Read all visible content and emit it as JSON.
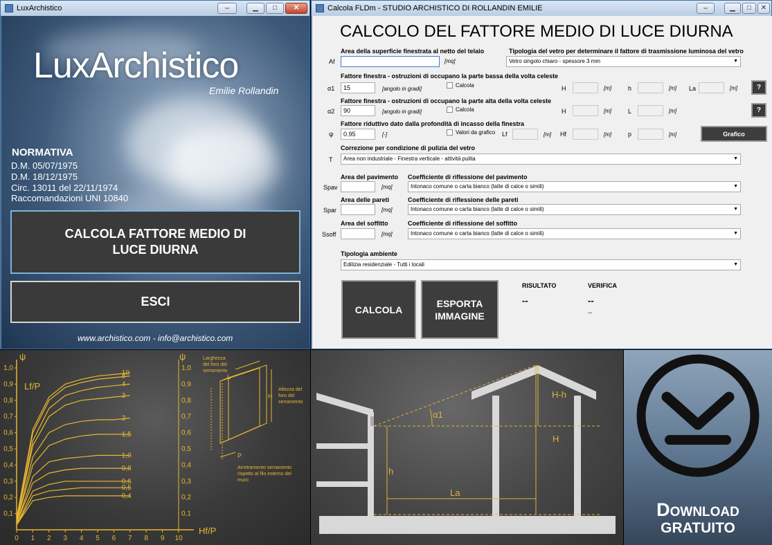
{
  "left_window": {
    "title": "LuxArchistico",
    "app_title": "LuxArchistico",
    "author": "Emilie Rollandin",
    "normativa_title": "NORMATIVA",
    "normativa_lines": [
      "D.M. 05/07/1975",
      "D.M. 18/12/1975",
      "Circ. 13011 del 22/11/1974",
      "Raccomandazioni UNI 10840"
    ],
    "calc_button_line1": "CALCOLA FATTORE MEDIO DI",
    "calc_button_line2": "LUCE DIURNA",
    "exit_button": "ESCI",
    "footer": "www.archistico.com - info@archistico.com"
  },
  "right_window": {
    "title": "Calcola FLDm - STUDIO ARCHISTICO DI ROLLANDIN EMILIE",
    "heading": "CALCOLO DEL FATTORE MEDIO DI LUCE DIURNA",
    "af_label": "Area della superficie finestrata al netto del telaio",
    "af_symbol": "Af",
    "af_value": "",
    "af_unit": "[mq]",
    "glass_label": "Tipologia del vetro per determinare il fattore di trasmissione luminosa del vetro",
    "glass_value": "Vetro singolo chiaro - spessore 3 mm",
    "a1_label": "Fattore finestra - ostruzioni di occupano la parte bassa della volta celeste",
    "a1_symbol": "α1",
    "a1_value": "15",
    "a1_unit": "[angolo in gradi]",
    "a1_calc": "Calcola",
    "a2_label": "Fattore finestra - ostruzioni di occupano la parte alta della volta celeste",
    "a2_symbol": "α2",
    "a2_value": "90",
    "a2_unit": "[angolo in gradi]",
    "a2_calc": "Calcola",
    "psi_label": "Fattore riduttivo dato dalla profondità di incasso della finestra",
    "psi_symbol": "ψ",
    "psi_value": "0.95",
    "psi_unit": "[-]",
    "psi_check": "Valori da grafico",
    "h_label": "H",
    "h2_label": "h",
    "la_label": "La",
    "l_label": "L",
    "lf_label": "Lf",
    "hf_label": "Hf",
    "p_label": "p",
    "m_unit": "[m]",
    "help": "?",
    "graph_button": "Grafico",
    "clean_label": "Correzione per condizione di pulizia del vetro",
    "clean_symbol": "T",
    "clean_value": "Area non industriale - Finestra verticale - attività pulita",
    "floor_area_label": "Area del pavimento",
    "floor_symbol": "Spav",
    "floor_unit": "[mq]",
    "floor_coef_label": "Coefficiente di riflessione del pavimento",
    "floor_coef_value": "Intonaco comune o carta bianco (latte di calce o simili)",
    "wall_area_label": "Area delle pareti",
    "wall_symbol": "Spar",
    "wall_unit": "[mq]",
    "wall_coef_label": "Coefficiente di riflessione delle pareti",
    "wall_coef_value": "Intonaco comune o carta bianco (latte di calce o simili)",
    "ceil_area_label": "Area del soffitto",
    "ceil_symbol": "Ssoff",
    "ceil_unit": "[mq]",
    "ceil_coef_label": "Coefficiente di riflessione del soffitto",
    "ceil_coef_value": "Intonaco comune o carta bianco (latte di calce o simili)",
    "env_label": "Tipologia ambiente",
    "env_value": "Edilizia residenziale - Tutti i locali",
    "calc_button": "CALCOLA",
    "export_line1": "ESPORTA",
    "export_line2": "IMMAGINE",
    "result_label": "RISULTATO",
    "result_value": "--",
    "verify_label": "VERIFICA",
    "verify_value": "--",
    "verify_sub": "--"
  },
  "chart_data": {
    "type": "line",
    "xlabel": "Hf/P",
    "ylabel": "ψ",
    "xlim": [
      0,
      10
    ],
    "ylim": [
      0,
      1
    ],
    "x_ticks": [
      "0",
      "1",
      "2",
      "3",
      "4",
      "5",
      "6",
      "7",
      "8",
      "9",
      "10"
    ],
    "y_ticks": [
      "0,1",
      "0,2",
      "0,3",
      "0,4",
      "0,5",
      "0,6",
      "0,7",
      "0,8",
      "0,9",
      "1,0"
    ],
    "curve_family_label": "Lf/P",
    "series": [
      {
        "name": "10",
        "x": [
          0,
          1,
          2,
          3,
          4,
          5,
          6,
          7
        ],
        "y": [
          0.07,
          0.62,
          0.82,
          0.9,
          0.93,
          0.95,
          0.96,
          0.97
        ]
      },
      {
        "name": "8",
        "x": [
          0,
          1,
          2,
          3,
          4,
          5,
          6,
          7
        ],
        "y": [
          0.07,
          0.6,
          0.8,
          0.88,
          0.91,
          0.93,
          0.94,
          0.95
        ]
      },
      {
        "name": "4",
        "x": [
          0,
          1,
          2,
          3,
          4,
          5,
          6,
          7
        ],
        "y": [
          0.06,
          0.55,
          0.75,
          0.83,
          0.86,
          0.88,
          0.89,
          0.9
        ]
      },
      {
        "name": "3",
        "x": [
          0,
          1,
          2,
          3,
          4,
          5,
          6,
          7
        ],
        "y": [
          0.06,
          0.52,
          0.7,
          0.77,
          0.8,
          0.81,
          0.82,
          0.83
        ]
      },
      {
        "name": "2",
        "x": [
          0,
          1,
          2,
          3,
          4,
          5,
          6,
          7
        ],
        "y": [
          0.05,
          0.45,
          0.6,
          0.65,
          0.67,
          0.68,
          0.68,
          0.69
        ]
      },
      {
        "name": "1,5",
        "x": [
          0,
          1,
          2,
          3,
          4,
          5,
          6,
          7
        ],
        "y": [
          0.05,
          0.4,
          0.52,
          0.56,
          0.58,
          0.59,
          0.59,
          0.59
        ]
      },
      {
        "name": "1,0",
        "x": [
          0,
          1,
          2,
          3,
          4,
          5,
          6,
          7
        ],
        "y": [
          0.04,
          0.33,
          0.42,
          0.44,
          0.45,
          0.46,
          0.46,
          0.46
        ]
      },
      {
        "name": "0,8",
        "x": [
          0,
          1,
          2,
          3,
          4,
          5,
          6,
          7
        ],
        "y": [
          0.04,
          0.29,
          0.35,
          0.37,
          0.38,
          0.38,
          0.38,
          0.38
        ]
      },
      {
        "name": "0,6",
        "x": [
          0,
          1,
          2,
          3,
          4,
          5,
          6,
          7
        ],
        "y": [
          0.03,
          0.24,
          0.28,
          0.3,
          0.3,
          0.3,
          0.3,
          0.3
        ]
      },
      {
        "name": "0,5",
        "x": [
          0,
          1,
          2,
          3,
          4,
          5,
          6,
          7
        ],
        "y": [
          0.03,
          0.21,
          0.24,
          0.25,
          0.26,
          0.26,
          0.26,
          0.26
        ]
      },
      {
        "name": "0,4",
        "x": [
          0,
          1,
          2,
          3,
          4,
          5,
          6,
          7
        ],
        "y": [
          0.03,
          0.18,
          0.2,
          0.21,
          0.21,
          0.21,
          0.21,
          0.21
        ]
      }
    ],
    "annotations": {
      "width_note": [
        "Larghezza",
        "del foro del",
        "serramento"
      ],
      "height_note": [
        "Altezza del",
        "foro del",
        "serramento"
      ],
      "recess_note": [
        "Arretramento serramento",
        "rispetto al filo esterno del",
        "muro"
      ],
      "L": "L",
      "H": "H",
      "P": "P"
    }
  },
  "diagram": {
    "labels": {
      "alpha1": "α1",
      "Hh": "H-h",
      "H": "H",
      "h": "h",
      "La": "La"
    }
  },
  "download": {
    "line1": "Download",
    "line2": "GRATUITO"
  },
  "colors": {
    "chart_line": "#e8b830",
    "dark_button": "#3a3a3a",
    "diagram_line": "#e0b040"
  }
}
